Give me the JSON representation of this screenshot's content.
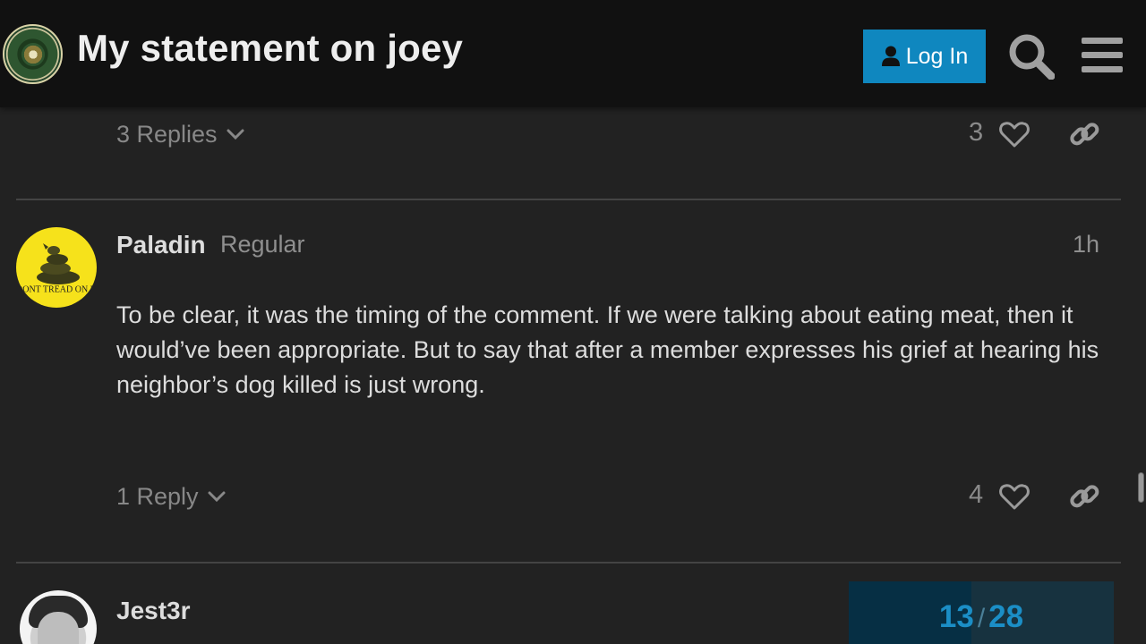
{
  "header": {
    "logo": "infowars-army-seal",
    "logo_text_top": "INFOWARS",
    "logo_text_bottom": "ARMY",
    "title": "My statement on joey",
    "login_label": "Log In",
    "icons": {
      "login": "user-icon",
      "search": "search-icon",
      "menu": "hamburger-menu-icon"
    }
  },
  "posts": [
    {
      "replies_label": "3 Replies",
      "likes": "3"
    },
    {
      "author": "Paladin",
      "user_title": "Regular",
      "date": "1h",
      "avatar": "gadsden-flag-avatar",
      "avatar_text": "DONT TREAD ON ME",
      "body": "To be clear, it was the timing of the comment. If we were talking about eating meat, then it would’ve been appropriate. But to say that after a member expresses his grief at hearing his neighbor’s dog killed is just wrong.",
      "replies_label": "1 Reply",
      "likes": "4"
    },
    {
      "author": "Jest3r",
      "avatar": "user-photo-avatar"
    }
  ],
  "timeline": {
    "current": "13",
    "separator": "/",
    "total": "28",
    "fraction": 0.4643
  },
  "colors": {
    "background": "#222222",
    "header": "#111111",
    "accent": "#0f87bf",
    "progress_text": "#1b8ec6"
  }
}
